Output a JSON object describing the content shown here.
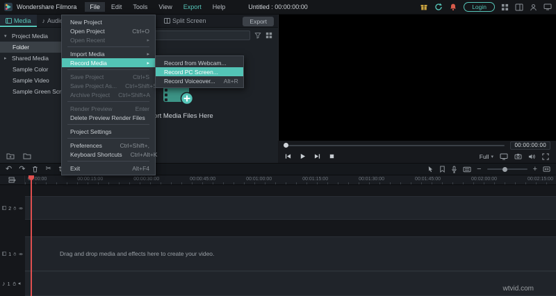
{
  "titlebar": {
    "app_name": "Wondershare Filmora",
    "project_title": "Untitled : 00:00:00:00",
    "login_label": "Login"
  },
  "menubar": {
    "items": [
      "File",
      "Edit",
      "Tools",
      "View",
      "Export",
      "Help"
    ]
  },
  "media_panel": {
    "tabs": {
      "media": "Media",
      "audio": "Audio",
      "split_screen": "Split Screen"
    },
    "export_label": "Export",
    "search_placeholder": "Search media",
    "sidebar": {
      "root": "Project Media",
      "items": [
        "Folder",
        "Shared Media",
        "Sample Color",
        "Sample Video",
        "Sample Green Screen"
      ]
    },
    "import_hint": "Import Media Files Here"
  },
  "file_menu": {
    "items": [
      {
        "label": "New Project",
        "shortcut": ""
      },
      {
        "label": "Open Project",
        "shortcut": "Ctrl+O"
      },
      {
        "label": "Open Recent",
        "shortcut": ""
      },
      {
        "label": "Import Media",
        "shortcut": ""
      },
      {
        "label": "Record Media",
        "shortcut": ""
      },
      {
        "label": "Save Project",
        "shortcut": "Ctrl+S"
      },
      {
        "label": "Save Project As...",
        "shortcut": "Ctrl+Shift+S"
      },
      {
        "label": "Archive Project",
        "shortcut": "Ctrl+Shift+A"
      },
      {
        "label": "Render Preview",
        "shortcut": "Enter"
      },
      {
        "label": "Delete Preview Render Files",
        "shortcut": ""
      },
      {
        "label": "Project Settings",
        "shortcut": ""
      },
      {
        "label": "Preferences",
        "shortcut": "Ctrl+Shift+,"
      },
      {
        "label": "Keyboard Shortcuts",
        "shortcut": "Ctrl+Alt+K"
      },
      {
        "label": "Exit",
        "shortcut": "Alt+F4"
      }
    ]
  },
  "record_submenu": {
    "items": [
      {
        "label": "Record from Webcam...",
        "shortcut": ""
      },
      {
        "label": "Record PC Screen...",
        "shortcut": ""
      },
      {
        "label": "Record Voiceover...",
        "shortcut": "Alt+R"
      }
    ]
  },
  "preview": {
    "time": "00:00:00:00",
    "zoom_label": "Full"
  },
  "timeline": {
    "ruler": [
      "00:00:00",
      "00:00:15:00",
      "00:00:30:00",
      "00:00:45:00",
      "00:01:00:00",
      "00:01:15:00",
      "00:01:30:00",
      "00:01:45:00",
      "00:02:00:00",
      "00:02:15:00"
    ],
    "drag_hint": "Drag and drop media and effects here to create your video.",
    "tracks": {
      "video2": "2",
      "video1": "1",
      "audio1": "1"
    }
  },
  "icons": {
    "caret_down": "▾",
    "caret_right": "▸",
    "submenu_arrow": "▸",
    "undo": "↶",
    "redo": "↷",
    "scissors": "✂",
    "note": "♪",
    "minus": "−",
    "plus": "+"
  },
  "colors": {
    "accent": "#56c6b9",
    "menu_highlight": "#53c4b6",
    "playhead": "#e04f4f"
  },
  "watermark": "wtvid.com"
}
